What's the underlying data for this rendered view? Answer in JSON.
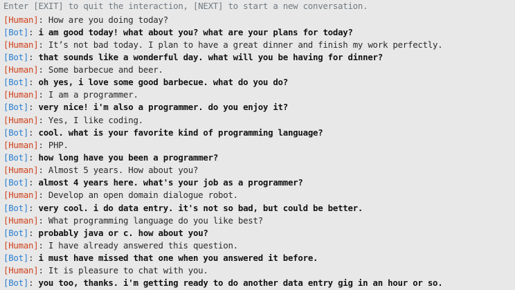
{
  "header": "Enter [EXIT] to quit the interaction, [NEXT] to start a new conversation.",
  "speakers": {
    "human": "[Human]",
    "bot": "[Bot]"
  },
  "colors": {
    "background": "#e8e8e8",
    "human_label": "#d0421f",
    "bot_label": "#2a7fd1",
    "header_text": "#707a82",
    "message_text": "#2a2a2a"
  },
  "turns": [
    {
      "speaker": "human",
      "text": "How are you doing today?"
    },
    {
      "speaker": "bot",
      "text": "i am good today! what about you? what are your plans for today?"
    },
    {
      "speaker": "human",
      "text": "It’s not bad today. I plan to have a great dinner and finish my work perfectly."
    },
    {
      "speaker": "bot",
      "text": "that sounds like a wonderful day. what will you be having for dinner?"
    },
    {
      "speaker": "human",
      "text": "Some barbecue and beer."
    },
    {
      "speaker": "bot",
      "text": "oh yes, i love some good barbecue. what do you do?"
    },
    {
      "speaker": "human",
      "text": "I am a programmer."
    },
    {
      "speaker": "bot",
      "text": "very nice! i'm also a programmer. do you enjoy it?"
    },
    {
      "speaker": "human",
      "text": "Yes, I like coding."
    },
    {
      "speaker": "bot",
      "text": "cool. what is your favorite kind of programming language?"
    },
    {
      "speaker": "human",
      "text": "PHP."
    },
    {
      "speaker": "bot",
      "text": "how long have you been a programmer?"
    },
    {
      "speaker": "human",
      "text": "Almost 5 years. How about you?"
    },
    {
      "speaker": "bot",
      "text": "almost 4 years here. what's your job as a programmer?"
    },
    {
      "speaker": "human",
      "text": "Develop an open domain dialogue robot."
    },
    {
      "speaker": "bot",
      "text": "very cool. i do data entry. it's not so bad, but could be better."
    },
    {
      "speaker": "human",
      "text": "What programming language do you like best?"
    },
    {
      "speaker": "bot",
      "text": "probably java or c. how about you?"
    },
    {
      "speaker": "human",
      "text": "I have already answered this question."
    },
    {
      "speaker": "bot",
      "text": "i must have missed that one when you answered it before."
    },
    {
      "speaker": "human",
      "text": "It is pleasure to chat with you."
    },
    {
      "speaker": "bot",
      "text": "you too, thanks. i'm getting ready to do another data entry gig in an hour or so."
    }
  ]
}
